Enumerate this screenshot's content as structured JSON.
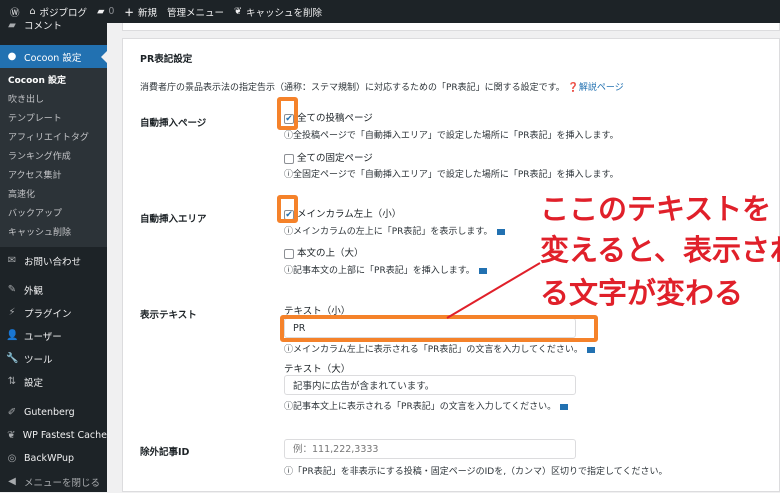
{
  "adminbar": {
    "site": "ポジブログ",
    "comments": "0",
    "new": "新規",
    "admin_menu": "管理メニュー",
    "cache": "キャッシュを削除"
  },
  "sidebar": {
    "comments": "コメント",
    "cocoon": "Cocoon 設定",
    "submenu": [
      "Cocoon 設定",
      "吹き出し",
      "テンプレート",
      "アフィリエイトタグ",
      "ランキング作成",
      "アクセス集計",
      "高速化",
      "バックアップ",
      "キャッシュ削除"
    ],
    "items": [
      "お問い合わせ",
      "外観",
      "プラグイン",
      "ユーザー",
      "ツール",
      "設定",
      "Gutenberg",
      "WP Fastest Cache",
      "BackWPup",
      "メニューを閉じる"
    ]
  },
  "main": {
    "title": "PR表記設定",
    "description": "消費者庁の景品表示法の指定告示（通称：ステマ規制）に対応するための「PR表記」に関する設定です。",
    "help_link": "解説ページ",
    "auto_page": {
      "label": "自動挿入ページ",
      "opt1": "全ての投稿ページ",
      "opt1_checked": true,
      "help1": "全投稿ページで「自動挿入エリア」で設定した場所に「PR表記」を挿入します。",
      "opt2": "全ての固定ページ",
      "opt2_checked": false,
      "help2": "全固定ページで「自動挿入エリア」で設定した場所に「PR表記」を挿入します。"
    },
    "auto_area": {
      "label": "自動挿入エリア",
      "opt1": "メインカラム左上（小）",
      "opt1_checked": true,
      "help1": "メインカラムの左上に「PR表記」を表示します。",
      "opt2": "本文の上（大）",
      "opt2_checked": false,
      "help2": "記事本文の上部に「PR表記」を挿入します。"
    },
    "display_text": {
      "label": "表示テキスト",
      "small_label": "テキスト（小）",
      "small_value": "PR",
      "small_help": "メインカラム左上に表示される「PR表記」の文言を入力してください。",
      "large_label": "テキスト（大）",
      "large_value": "記事内に広告が含まれています。",
      "large_help": "記事本文上に表示される「PR表記」の文言を入力してください。"
    },
    "exclude": {
      "label": "除外記事ID",
      "placeholder": "例：111,222,3333",
      "help": "「PR表記」を非表示にする投稿・固定ページのIDを,（カンマ）区切りで指定してください。"
    }
  },
  "annotation": {
    "line1": "ここのテキストを",
    "line2": "変えると、表示され",
    "line3": "る文字が変わる"
  }
}
